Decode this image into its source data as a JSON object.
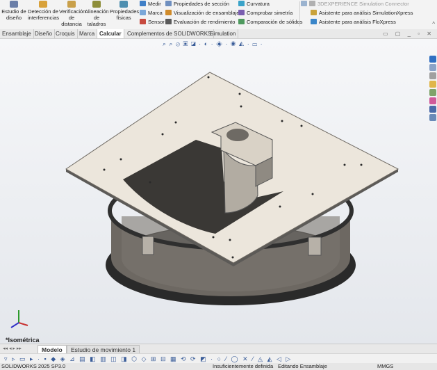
{
  "ribbon": {
    "large_buttons": [
      {
        "label": "Estudio de diseño",
        "icon": "study-icon"
      },
      {
        "label": "Detección de interferencias",
        "icon": "interference-icon"
      },
      {
        "label": "Verificación de distancia",
        "icon": "distance-icon"
      },
      {
        "label": "Alineación de taladros",
        "icon": "hole-align-icon"
      },
      {
        "label": "Propiedades físicas",
        "icon": "mass-props-icon"
      }
    ],
    "col1": [
      "Medir",
      "Marca",
      "Sensor"
    ],
    "col2": [
      "Propiedades de sección",
      "Visualización de ensamblajes",
      "Evaluación de rendimiento"
    ],
    "col3": [
      "Curvatura",
      "Comprobar simetría",
      "Comparación de sólidos"
    ],
    "col4": [
      "3DEXPERIENCE Simulation Connector",
      "Asistente para análisis SimulationXpress",
      "Asistente para análisis FloXpress"
    ]
  },
  "tabs": [
    "Ensamblaje",
    "Diseño",
    "Croquis",
    "Marca",
    "Calcular",
    "Complementos de SOLIDWORKS",
    "Simulation"
  ],
  "active_tab": "Calcular",
  "view_name": "*Isométrica",
  "bottom_tabs": [
    "Modelo",
    "Estudio de movimiento 1"
  ],
  "status": {
    "version": "SOLIDWORKS 2025 SP3.0",
    "definition": "Insuficientemente definida",
    "mode": "Editando Ensamblaje",
    "units": "MMGS"
  }
}
